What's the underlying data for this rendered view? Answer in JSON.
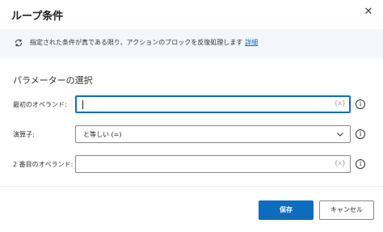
{
  "dialog": {
    "title": "ループ条件",
    "close_icon": "close-icon"
  },
  "info": {
    "icon": "loop-icon",
    "text": "指定された条件が真である限り、アクションのブロックを反復処理します",
    "link": "詳細"
  },
  "section": {
    "title": "パラメーターの選択"
  },
  "fields": {
    "first_operand": {
      "label": "最初のオペランド:",
      "value": "",
      "var_icon": "{x}"
    },
    "operator": {
      "label": "演算子:",
      "value": "と等しい (=)"
    },
    "second_operand": {
      "label": "2 番目のオペランド:",
      "value": "",
      "var_icon": "{x}"
    },
    "help_glyph": "i"
  },
  "buttons": {
    "save": "保存",
    "cancel": "キャンセル"
  },
  "colors": {
    "accent": "#0f6cbd",
    "info_bg": "#f3f6fb"
  }
}
